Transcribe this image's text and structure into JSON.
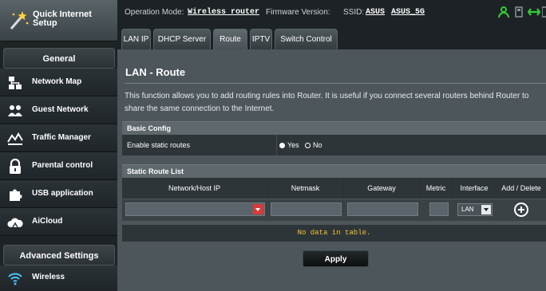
{
  "sidebar": {
    "quick_setup": "Quick Internet\nSetup",
    "general_header": "General",
    "general_items": [
      {
        "label": "Network Map",
        "icon": "network-map-icon"
      },
      {
        "label": "Guest Network",
        "icon": "guest-network-icon"
      },
      {
        "label": "Traffic Manager",
        "icon": "traffic-manager-icon"
      },
      {
        "label": "Parental control",
        "icon": "lock-icon"
      },
      {
        "label": "USB application",
        "icon": "puzzle-icon"
      },
      {
        "label": "AiCloud",
        "icon": "cloud-icon"
      }
    ],
    "advanced_header": "Advanced Settings",
    "advanced_items": [
      {
        "label": "Wireless",
        "icon": "wifi-icon"
      }
    ]
  },
  "topbar": {
    "op_mode_label": "Operation Mode:",
    "op_mode_value": "Wireless router",
    "firmware_label": "Firmware Version:",
    "ssid_label": "SSID:",
    "ssid_1": "ASUS",
    "ssid_2": "ASUS_5G"
  },
  "tabs": [
    "LAN IP",
    "DHCP Server",
    "Route",
    "IPTV",
    "Switch Control"
  ],
  "active_tab": "Route",
  "main": {
    "title": "LAN - Route",
    "description": "This function allows you to add routing rules into Router. It is useful if you connect several routers behind Router to share the same connection to the Internet.",
    "basic_config": {
      "header": "Basic Config",
      "enable_label": "Enable static routes",
      "option_yes": "Yes",
      "option_no": "No",
      "selected": "Yes"
    },
    "static_route_list": {
      "header": "Static Route List",
      "columns": [
        "Network/Host IP",
        "Netmask",
        "Gateway",
        "Metric",
        "Interface",
        "Add / Delete"
      ],
      "interface_value": "LAN",
      "empty_message": "No data in table."
    },
    "apply_label": "Apply"
  },
  "colors": {
    "panel": "#4c565b",
    "dark_row": "#2e3539",
    "empty_text": "#f2c230",
    "select_accent": "#d83a3a",
    "status_green": "#33cc33"
  }
}
